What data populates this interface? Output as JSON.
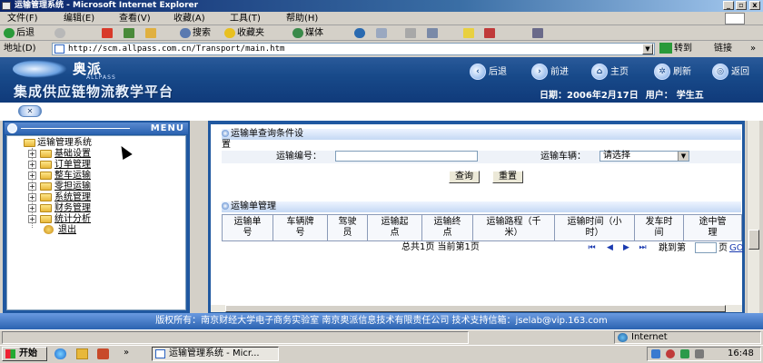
{
  "window": {
    "title": "运输管理系统 - Microsoft Internet Explorer",
    "controls": [
      "_",
      "▫",
      "x"
    ]
  },
  "menubar": {
    "items": [
      "文件(F)",
      "编辑(E)",
      "查看(V)",
      "收藏(A)",
      "工具(T)",
      "帮助(H)"
    ]
  },
  "toolbar": {
    "back": "后退",
    "search": "搜索",
    "favorites": "收藏夹",
    "media": "媒体"
  },
  "addressbar": {
    "label": "地址(D)",
    "url": "http://scm.allpass.com.cn/Transport/main.htm",
    "go": "转到",
    "links": "链接"
  },
  "header": {
    "brand": "奥派",
    "brand_sub": "ALLPASS",
    "platform": "集成供应链物流教学平台",
    "nav": [
      "后退",
      "前进",
      "主页",
      "刷新",
      "返回"
    ],
    "date_label": "日期：",
    "date": "2006年2月17日",
    "user_label": "用户：",
    "user": "学生五"
  },
  "menu": {
    "title": "MENU",
    "root": "运输管理系统",
    "items": [
      "基础设置",
      "订单管理",
      "整车运输",
      "零担运输",
      "系统管理",
      "财务管理",
      "统计分析"
    ],
    "logout": "退出"
  },
  "query": {
    "title_line1": "运输单查询条件设",
    "title_line2": "置",
    "field1_label": "运输编号：",
    "field1_value": "",
    "field2_label": "运输车辆：",
    "field2_value": "请选择",
    "search_button": "查询",
    "reset_button": "重置"
  },
  "manage": {
    "title": "运输单管理",
    "columns": [
      [
        "运输单",
        "号"
      ],
      [
        "车辆牌",
        "号"
      ],
      [
        "驾驶",
        "员"
      ],
      [
        "运输起",
        "点"
      ],
      [
        "运输终",
        "点"
      ],
      [
        "运输路程（千",
        "米）"
      ],
      [
        "运输时间（小",
        "时）"
      ],
      [
        "发车时",
        "间"
      ],
      [
        "途中管",
        "理"
      ]
    ],
    "pager_text": "总共1页 当前第1页",
    "jump_label": "跳到第",
    "page_unit": "页",
    "go_label": "GO"
  },
  "footer": {
    "text": "版权所有：南京财经大学电子商务实验室 南京奥派信息技术有限责任公司 技术支持信箱：jselab@vip.163.com"
  },
  "statusbar": {
    "zone": "Internet"
  },
  "taskbar": {
    "start": "开始",
    "task": "运输管理系统 - Micr...",
    "time": "16:48"
  }
}
